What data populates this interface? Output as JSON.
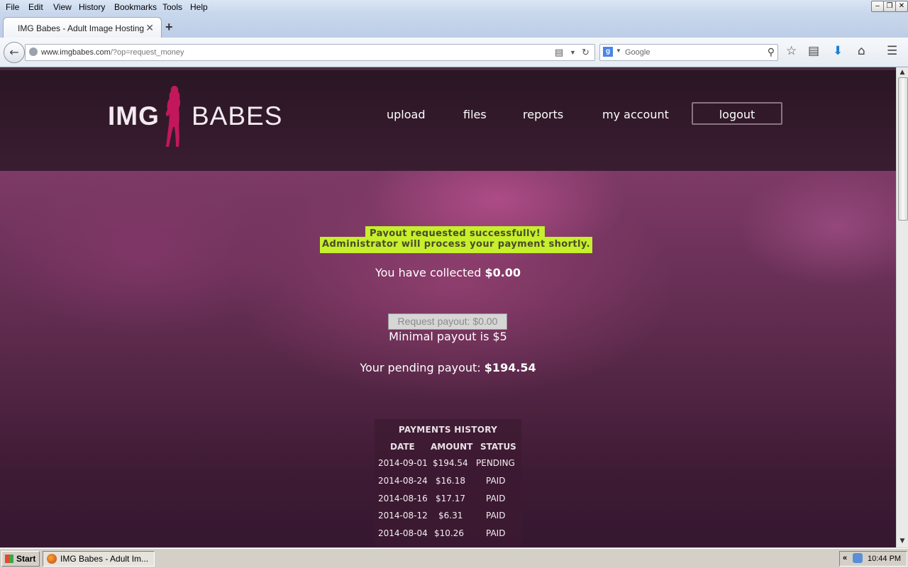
{
  "browser": {
    "menu": [
      "File",
      "Edit",
      "View",
      "History",
      "Bookmarks",
      "Tools",
      "Help"
    ],
    "tab_title": "IMG Babes - Adult Image Hosting",
    "url_host": "www.imgbabes.com",
    "url_path": "/?op=request_money",
    "search_placeholder": "Google"
  },
  "site": {
    "logo_left": "IMG",
    "logo_right": "BABES",
    "nav": [
      "upload",
      "files",
      "reports",
      "my account"
    ],
    "logout_label": "logout",
    "brand_color": "#c2185b"
  },
  "main": {
    "message_line1": "Payout requested successfully!",
    "message_line2": "Administrator will process your payment shortly.",
    "collected_prefix": "You have collected ",
    "collected_amount": "$0.00",
    "request_button": "Request payout: $0.00",
    "minimal_payout": "Minimal payout is $5",
    "pending_prefix": "Your pending payout: ",
    "pending_amount": "$194.54"
  },
  "history": {
    "title": "PAYMENTS HISTORY",
    "columns": [
      "DATE",
      "AMOUNT",
      "STATUS"
    ],
    "rows": [
      [
        "2014-09-01",
        "$194.54",
        "PENDING"
      ],
      [
        "2014-08-24",
        "$16.18",
        "PAID"
      ],
      [
        "2014-08-16",
        "$17.17",
        "PAID"
      ],
      [
        "2014-08-12",
        "$6.31",
        "PAID"
      ],
      [
        "2014-08-04",
        "$10.26",
        "PAID"
      ]
    ]
  },
  "taskbar": {
    "start_label": "Start",
    "task_label": "IMG Babes - Adult Im...",
    "clock": "10:44 PM"
  }
}
